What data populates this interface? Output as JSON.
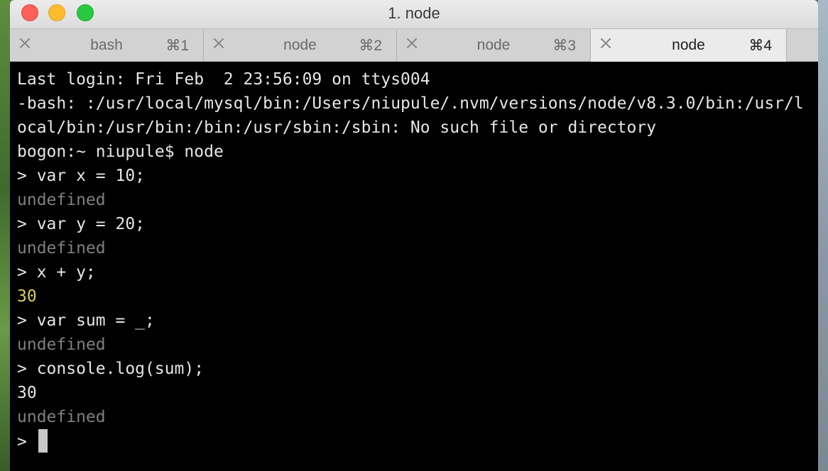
{
  "window": {
    "title": "1. node"
  },
  "tabs": [
    {
      "label": "bash",
      "shortcut": "⌘1",
      "active": false
    },
    {
      "label": "node",
      "shortcut": "⌘2",
      "active": false
    },
    {
      "label": "node",
      "shortcut": "⌘3",
      "active": false
    },
    {
      "label": "node",
      "shortcut": "⌘4",
      "active": true
    }
  ],
  "terminal": {
    "lines": [
      {
        "text": "Last login: Fri Feb  2 23:56:09 on ttys004",
        "kind": "plain"
      },
      {
        "text": "-bash: :/usr/local/mysql/bin:/Users/niupule/.nvm/versions/node/v8.3.0/bin:/usr/l",
        "kind": "plain"
      },
      {
        "text": "ocal/bin:/usr/bin:/bin:/usr/sbin:/sbin: No such file or directory",
        "kind": "plain"
      },
      {
        "text": "bogon:~ niupule$ node",
        "kind": "plain"
      },
      {
        "text": "> var x = 10;",
        "kind": "plain"
      },
      {
        "text": "undefined",
        "kind": "undef"
      },
      {
        "text": "> var y = 20;",
        "kind": "plain"
      },
      {
        "text": "undefined",
        "kind": "undef"
      },
      {
        "text": "> x + y;",
        "kind": "plain"
      },
      {
        "text": "30",
        "kind": "num-yellow"
      },
      {
        "text": "> var sum = _;",
        "kind": "plain"
      },
      {
        "text": "undefined",
        "kind": "undef"
      },
      {
        "text": "> console.log(sum);",
        "kind": "plain"
      },
      {
        "text": "30",
        "kind": "plain"
      },
      {
        "text": "undefined",
        "kind": "undef"
      }
    ],
    "prompt": "> "
  },
  "colors": {
    "close": "#fc5f57",
    "minimize": "#fdbc2e",
    "zoom": "#28c840",
    "undefined_text": "#7f7f7f",
    "number_yellow": "#d9cf52"
  }
}
